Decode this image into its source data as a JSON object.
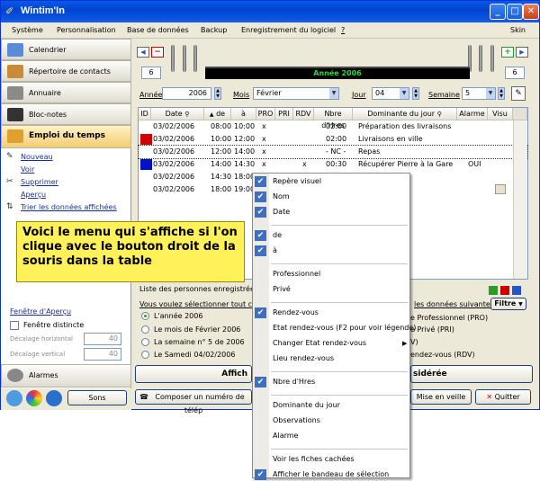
{
  "window": {
    "title": "Wintim'In",
    "icon": "wintim-logo-icon"
  },
  "menubar": [
    "Système",
    "Personnalisation",
    "Base de données",
    "Backup",
    "Enregistrement du logiciel",
    "?",
    "Skin"
  ],
  "nav": {
    "calendrier": "Calendrier",
    "contacts": "Répertoire de contacts",
    "annuaire": "Annuaire",
    "blocnotes": "Bloc-notes",
    "emploi": "Emploi du temps",
    "alarmes": "Alarmes"
  },
  "actions": {
    "nouveau": "Nouveau",
    "voir": "Voir",
    "supprimer": "Supprimer",
    "apercu": "Aperçu",
    "trier": "Trier les données affichées"
  },
  "apercu_panel": {
    "title": "Fenêtre d'Aperçu",
    "distincte": "Fenêtre distincte",
    "decal_h_label": "Décalage horizontal",
    "decal_h_value": "40",
    "decal_v_label": "Décalage vertical",
    "decal_v_value": "40"
  },
  "yearbar": {
    "left_num": "6",
    "right_num": "6",
    "label": "Année 2006"
  },
  "filters": {
    "annee_label": "Année",
    "annee_value": "2006",
    "mois_label": "Mois",
    "mois_value": "Février",
    "jour_label": "Jour",
    "jour_value": "04",
    "semaine_label": "Semaine",
    "semaine_value": "5"
  },
  "table": {
    "headers": [
      "ID",
      "Date",
      "de",
      "à",
      "PRO",
      "PRI",
      "RDV",
      "Nbre d'Hres",
      "Dominante du jour",
      "Alarme",
      "Visu"
    ],
    "rows": [
      {
        "color": "",
        "date": "03/02/2006",
        "de": "08:00",
        "a": "10:00",
        "pro": "x",
        "pri": "",
        "rdv": "",
        "hres": "02:00",
        "dom": "Préparation des livraisons",
        "alarme": "",
        "visu": ""
      },
      {
        "color": "#d40000",
        "date": "03/02/2006",
        "de": "10:00",
        "a": "12:00",
        "pro": "x",
        "pri": "",
        "rdv": "",
        "hres": "02:00",
        "dom": "Livraisons en ville",
        "alarme": "",
        "visu": ""
      },
      {
        "color": "",
        "date": "03/02/2006",
        "de": "12:00",
        "a": "14:00",
        "pro": "x",
        "pri": "",
        "rdv": "",
        "hres": "- NC -",
        "dom": "Repas",
        "alarme": "",
        "visu": ""
      },
      {
        "color": "#0010c8",
        "date": "03/02/2006",
        "de": "14:00",
        "a": "14:30",
        "pro": "x",
        "pri": "",
        "rdv": "x",
        "hres": "00:30",
        "dom": "Récupérer Pierre à la Gare",
        "alarme": "OUI",
        "visu": ""
      },
      {
        "color": "",
        "date": "03/02/2006",
        "de": "14:30",
        "a": "18:00",
        "pro": "",
        "pri": "",
        "rdv": "",
        "hres": "",
        "dom": "",
        "alarme": "",
        "visu": ""
      },
      {
        "color": "",
        "date": "03/02/2006",
        "de": "18:00",
        "a": "19:00",
        "pro": "",
        "pri": "",
        "rdv": "",
        "hres": "",
        "dom": "abelle",
        "alarme": "",
        "visu": "note-icon"
      }
    ]
  },
  "persons_label": "Liste des personnes enregistrées da",
  "period": {
    "question": "Vous voulez sélectionner tout ce qu",
    "options": [
      "L'année 2006",
      "Le mois de Février 2006",
      "La semaine n° 5 de 2006",
      "Le Samedi 04/02/2006"
    ]
  },
  "right_filter": {
    "title": "les données suivantes",
    "btn": "Filtre",
    "opt1": "e Professionnel (PRO)",
    "opt2": "e Privé (PRI)",
    "opt3": "V)",
    "opt4": "endez-vous (RDV)"
  },
  "bottom": {
    "affich": "Affich",
    "sidere": "sidérée",
    "sons": "Sons",
    "composer": "Composer un numéro de télép",
    "veille": "Mise en veille",
    "quitter": "Quitter"
  },
  "note": "Voici le menu qui s'affiche si l'on clique avec le bouton droit de la souris dans la table",
  "context_menu": [
    {
      "label": "Repère visuel",
      "checked": true
    },
    {
      "label": "Nom",
      "checked": true
    },
    {
      "label": "Date",
      "checked": true
    },
    {
      "sep": true
    },
    {
      "label": "de",
      "checked": true
    },
    {
      "label": "à",
      "checked": true
    },
    {
      "sep": true
    },
    {
      "label": "Professionnel",
      "checked": false
    },
    {
      "label": "Privé",
      "checked": false
    },
    {
      "sep": true
    },
    {
      "label": "Rendez-vous",
      "checked": true
    },
    {
      "label": "Etat rendez-vous  (F2 pour voir légende)",
      "checked": false
    },
    {
      "label": "Changer Etat rendez-vous",
      "checked": false,
      "submenu": true
    },
    {
      "label": "Lieu rendez-vous",
      "checked": false
    },
    {
      "sep": true
    },
    {
      "label": "Nbre d'Hres",
      "checked": true
    },
    {
      "sep": true
    },
    {
      "label": "Dominante du jour",
      "checked": false
    },
    {
      "label": "Observations",
      "checked": false
    },
    {
      "label": "Alarme",
      "checked": false
    },
    {
      "sep": true
    },
    {
      "label": "Voir les fiches cachées",
      "checked": false
    },
    {
      "label": "Afficher le bandeau de sélection",
      "checked": true
    }
  ],
  "colors": {
    "title_bar": "#0a5ae8",
    "year_text": "#33d33d",
    "note_bg": "#fff15a",
    "check_bg": "#3e6fc1"
  }
}
